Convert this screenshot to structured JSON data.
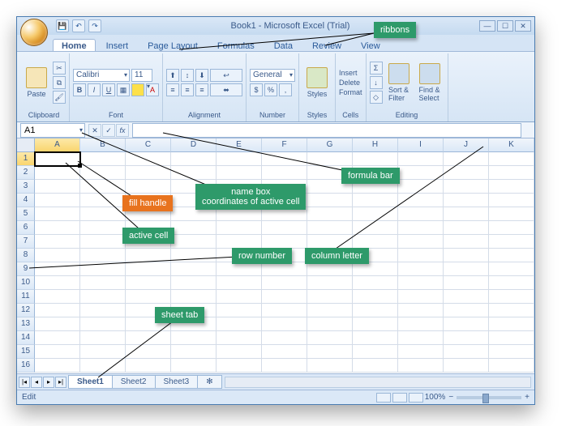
{
  "title": "Book1 - Microsoft Excel (Trial)",
  "qat": {
    "save": "💾",
    "undo": "↶",
    "redo": "↷"
  },
  "tabs": [
    "Home",
    "Insert",
    "Page Layout",
    "Formulas",
    "Data",
    "Review",
    "View"
  ],
  "ribbon": {
    "clipboard": {
      "paste": "Paste",
      "label": "Clipboard"
    },
    "font": {
      "name": "Calibri",
      "size": "11",
      "label": "Font",
      "b": "B",
      "i": "I",
      "u": "U"
    },
    "alignment": {
      "label": "Alignment"
    },
    "number": {
      "format": "General",
      "label": "Number"
    },
    "styles": {
      "label": "Styles",
      "btn": "Styles"
    },
    "cells": {
      "insert": "Insert",
      "delete": "Delete",
      "format": "Format",
      "label": "Cells"
    },
    "editing": {
      "sort": "Sort &\nFilter",
      "find": "Find &\nSelect",
      "label": "Editing"
    }
  },
  "namebox": "A1",
  "fb": {
    "cancel": "✕",
    "enter": "✓",
    "fx": "fx"
  },
  "columns": [
    "A",
    "B",
    "C",
    "D",
    "E",
    "F",
    "G",
    "H",
    "I",
    "J",
    "K"
  ],
  "rows": [
    "1",
    "2",
    "3",
    "4",
    "5",
    "6",
    "7",
    "8",
    "9",
    "10",
    "11",
    "12",
    "13",
    "14",
    "15",
    "16"
  ],
  "sheets": [
    "Sheet1",
    "Sheet2",
    "Sheet3"
  ],
  "status": "Edit",
  "zoom": "100%",
  "annotations": {
    "ribbons": "ribbons",
    "formula_bar": "formula bar",
    "name_box": "name box\ncoordinates of active cell",
    "fill_handle": "fill handle",
    "active_cell": "active cell",
    "row_number": "row number",
    "column_letter": "column letter",
    "sheet_tab": "sheet tab"
  }
}
